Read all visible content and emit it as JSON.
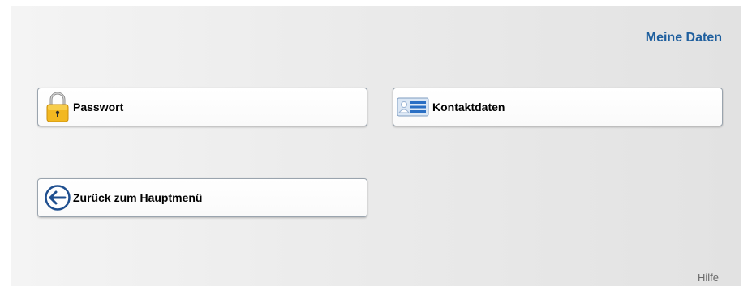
{
  "header": {
    "title": "Meine Daten"
  },
  "menu": {
    "password_label": "Passwort",
    "contact_label": "Kontaktdaten",
    "back_label": "Zurück zum Hauptmenü"
  },
  "footer": {
    "help_label": "Hilfe"
  },
  "icons": {
    "password": "padlock-icon",
    "contact": "contact-card-icon",
    "back": "arrow-left-icon"
  },
  "colors": {
    "title": "#1f5f9e",
    "lock_body": "#f2b821",
    "arrow_circle": "#1f4f8f",
    "card_accent": "#2a6fc4"
  }
}
